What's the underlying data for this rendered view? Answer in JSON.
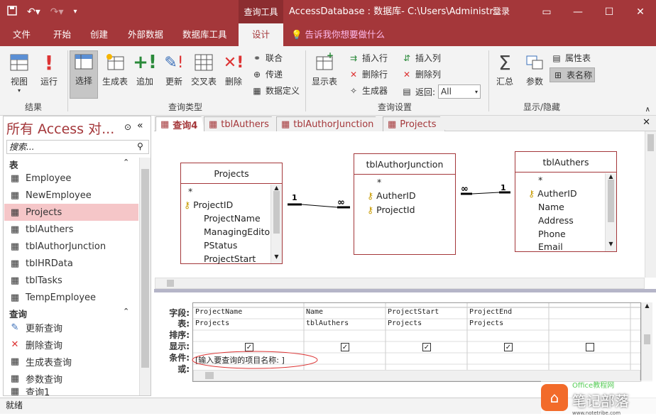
{
  "title_bar": {
    "context_tab": "查询工具",
    "doc_title": "AccessDatabase : 数据库- C:\\Users\\Administr...",
    "signin": "登录"
  },
  "tabs": [
    "文件",
    "开始",
    "创建",
    "外部数据",
    "数据库工具",
    "设计"
  ],
  "tell_me": "告诉我你想要做什么",
  "ribbon": {
    "results": {
      "label": "结果",
      "view": "视图",
      "run": "运行"
    },
    "query_type": {
      "label": "查询类型",
      "select": "选择",
      "make_table": "生成表",
      "append": "追加",
      "update": "更新",
      "crosstab": "交叉表",
      "delete": "删除",
      "union": "联合",
      "passthrough": "传递",
      "data_definition": "数据定义"
    },
    "query_setup": {
      "label": "查询设置",
      "show_table": "显示表",
      "insert_rows": "插入行",
      "delete_rows": "删除行",
      "builder": "生成器",
      "insert_cols": "插入列",
      "delete_cols": "删除列",
      "return": "返回:",
      "return_value": "All"
    },
    "show_hide": {
      "label": "显示/隐藏",
      "totals": "汇总",
      "parameters": "参数",
      "property_sheet": "属性表",
      "table_names": "表名称"
    }
  },
  "nav": {
    "title": "所有 Access 对...",
    "search_placeholder": "搜索...",
    "tables_header": "表",
    "tables": [
      "Employee",
      "NewEmployee",
      "Projects",
      "tblAuthers",
      "tblAuthorJunction",
      "tblHRData",
      "tblTasks",
      "TempEmployee"
    ],
    "selected_table": "Projects",
    "queries_header": "查询",
    "queries": [
      "更新查询",
      "删除查询",
      "生成表查询",
      "参数查询",
      "查询1"
    ]
  },
  "doc_tabs": [
    "查询4",
    "tblAuthers",
    "tblAuthorJunction",
    "Projects"
  ],
  "tables": {
    "projects": {
      "name": "Projects",
      "fields": [
        "*",
        "ProjectID",
        "ProjectName",
        "ManagingEditor",
        "PStatus",
        "ProjectStart"
      ]
    },
    "junction": {
      "name": "tblAuthorJunction",
      "fields": [
        "*",
        "AutherID",
        "ProjectId"
      ]
    },
    "authers": {
      "name": "tblAuthers",
      "fields": [
        "*",
        "AutherID",
        "Name",
        "Address",
        "Phone",
        "Email"
      ]
    }
  },
  "relations": {
    "one": "1",
    "many": "∞"
  },
  "grid": {
    "row_labels": [
      "字段:",
      "表:",
      "排序:",
      "显示:",
      "条件:",
      "或:"
    ],
    "columns": [
      {
        "field": "ProjectName",
        "table": "Projects",
        "show": true,
        "criteria": "[输入要查询的项目名称: ]"
      },
      {
        "field": "Name",
        "table": "tblAuthers",
        "show": true,
        "criteria": ""
      },
      {
        "field": "ProjectStart",
        "table": "Projects",
        "show": true,
        "criteria": ""
      },
      {
        "field": "ProjectEnd",
        "table": "Projects",
        "show": true,
        "criteria": ""
      },
      {
        "field": "",
        "table": "",
        "show": false,
        "criteria": ""
      }
    ]
  },
  "status": "就绪",
  "watermark": {
    "text": "笔记部落",
    "url": "www.notetribe.com",
    "corner": "Office教程网"
  },
  "colors": {
    "accent": "#a4373a",
    "selected_nav": "#f5c6c8"
  }
}
